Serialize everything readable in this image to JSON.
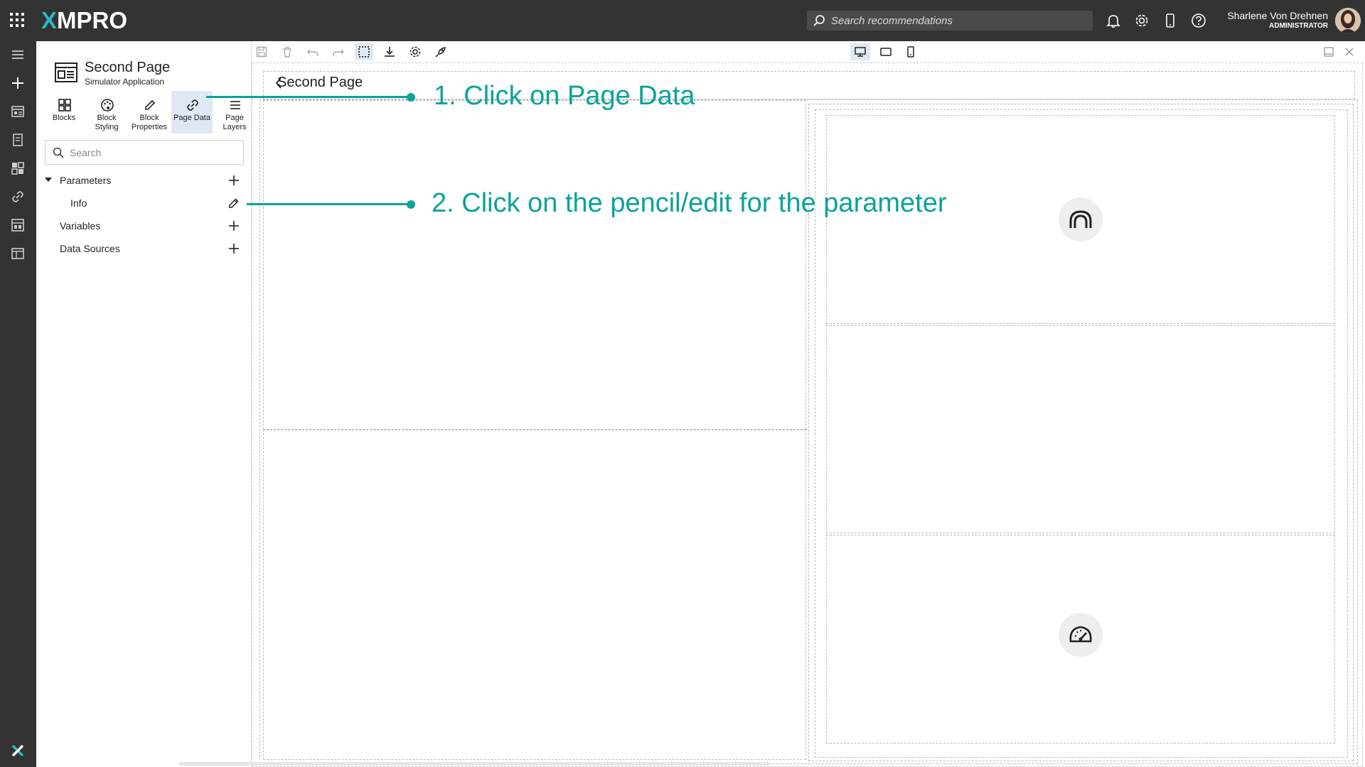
{
  "topbar": {
    "logo_x": "X",
    "logo_rest": "MPRO",
    "search_placeholder": "Search recommendations",
    "user_name": "Sharlene Von Drehnen",
    "user_role": "ADMINISTRATOR"
  },
  "panel": {
    "page_title": "Second Page",
    "page_subtitle": "Simulator Application",
    "tabs": [
      {
        "line1": "Blocks",
        "line2": ""
      },
      {
        "line1": "Block",
        "line2": "Styling"
      },
      {
        "line1": "Block",
        "line2": "Properties"
      },
      {
        "line1": "Page Data",
        "line2": ""
      },
      {
        "line1": "Page",
        "line2": "Layers"
      }
    ],
    "search_placeholder": "Search",
    "tree": {
      "parameters": "Parameters",
      "info": "Info",
      "variables": "Variables",
      "data_sources": "Data Sources"
    }
  },
  "canvas": {
    "breadcrumb": "Second Page"
  },
  "annotations": {
    "step1": "1. Click on Page Data",
    "step2": "2. Click on the pencil/edit for the parameter"
  },
  "colors": {
    "accent": "#0aa39a",
    "topbar": "#333333",
    "active_tab": "#dfe9f3"
  }
}
